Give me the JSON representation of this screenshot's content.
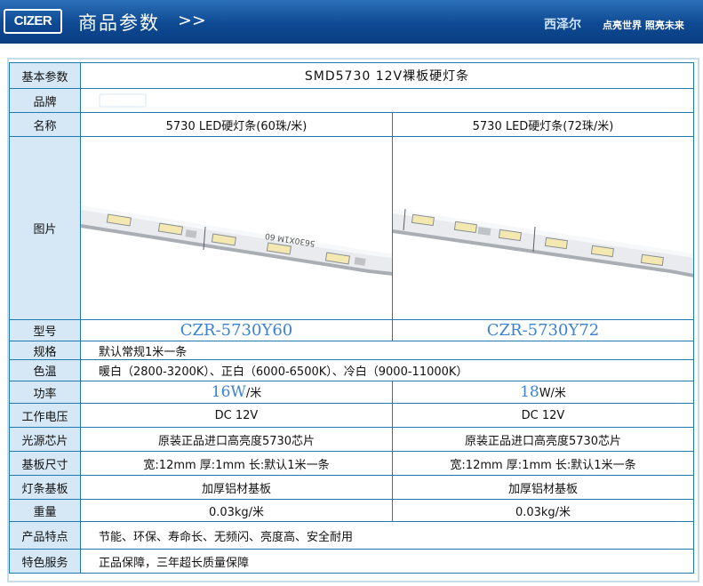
{
  "header": {
    "logo": "CIZER",
    "title": "商品参数",
    "arrow": ">>",
    "brand": "西泽尔",
    "slogan": "点亮世界 照亮未来"
  },
  "table": {
    "title_label": "基本参数",
    "title_value": "SMD5730 12V裸板硬灯条",
    "brand_label": "品牌",
    "brand_value": "",
    "name_label": "名称",
    "name_a": "5730 LED硬灯条(60珠/米)",
    "name_b": "5730 LED硬灯条(72珠/米)",
    "pic_label": "图片",
    "pic_a_text": "5630X1M 60",
    "model_label": "型号",
    "model_a": "CZR-5730Y60",
    "model_b": "CZR-5730Y72",
    "spec_label": "规格",
    "spec_value": "默认常规1米一条",
    "temp_label": "色温",
    "temp_value": "暖白（2800-3200K）、正白（6000-6500K）、冷白（9000-11000K）",
    "power_label": "功率",
    "power_a_num": "16W",
    "power_a_unit": "/米",
    "power_b_num": "18",
    "power_b_unit": "W/米",
    "voltage_label": "工作电压",
    "voltage_a": "DC 12V",
    "voltage_b": "DC 12V",
    "chip_label": "光源芯片",
    "chip_a": "原装正品进口高亮度5730芯片",
    "chip_b": "原装正品进口高亮度5730芯片",
    "size_label": "基板尺寸",
    "size_a": "宽:12mm 厚:1mm 长:默认1米一条",
    "size_b": "宽:12mm 厚:1mm 长:默认1米一条",
    "board_label": "灯条基板",
    "board_a": "加厚铝材基板",
    "board_b": "加厚铝材基板",
    "weight_label": "重量",
    "weight_a": "0.03kg/米",
    "weight_b": "0.03kg/米",
    "feature_label": "产品特点",
    "feature_value": "节能、环保、寿命长、无频闪、亮度高、安全耐用",
    "service_label": "特色服务",
    "service_value": "正品保障，三年超长质量保障"
  },
  "colors": {
    "header": "#0e4a93",
    "border": "#1f7ab0",
    "label_bg": "#d6e8f5",
    "accent": "#3a82d2"
  }
}
